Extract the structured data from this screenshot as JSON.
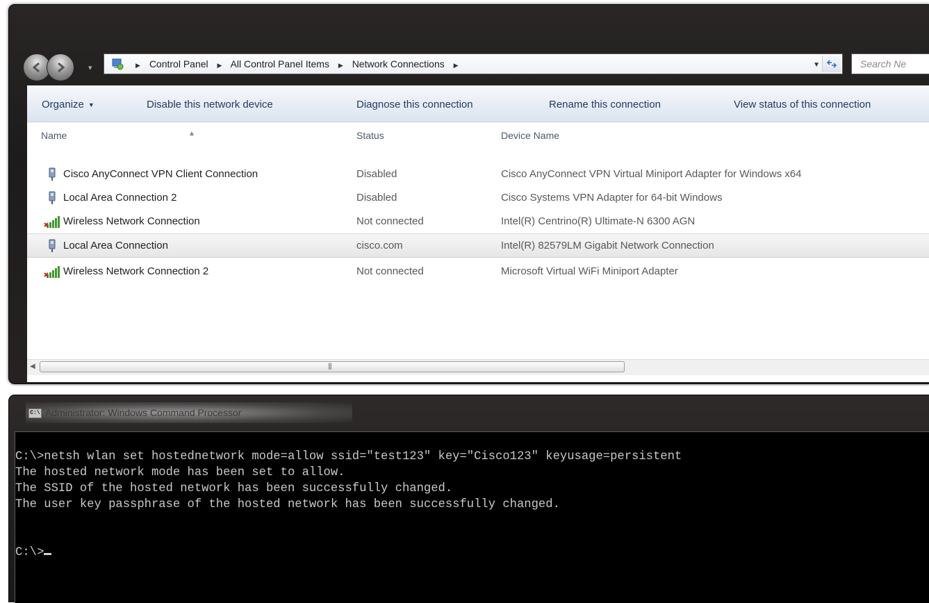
{
  "explorer": {
    "breadcrumb": [
      "Control Panel",
      "All Control Panel Items",
      "Network Connections"
    ],
    "search_placeholder": "Search Ne",
    "toolbar": {
      "organize": "Organize",
      "disable": "Disable this network device",
      "diagnose": "Diagnose this connection",
      "rename": "Rename this connection",
      "view_status": "View status of this connection"
    },
    "columns": {
      "name": "Name",
      "status": "Status",
      "device": "Device Name"
    },
    "connections": [
      {
        "name": "Cisco AnyConnect VPN Client Connection",
        "status": "Disabled",
        "device": "Cisco AnyConnect VPN Virtual Miniport Adapter for Windows x64",
        "icon": "wired-network-icon"
      },
      {
        "name": "Local Area Connection 2",
        "status": "Disabled",
        "device": "Cisco Systems VPN Adapter for 64-bit Windows",
        "icon": "wired-network-icon"
      },
      {
        "name": "Wireless Network Connection",
        "status": "Not connected",
        "device": "Intel(R) Centrino(R) Ultimate-N 6300 AGN",
        "icon": "wireless-signal-icon"
      },
      {
        "name": "Local Area Connection",
        "status": "cisco.com",
        "device": "Intel(R) 82579LM Gigabit Network Connection",
        "icon": "wired-network-icon"
      },
      {
        "name": "Wireless Network Connection 2",
        "status": "Not connected",
        "device": "Microsoft Virtual WiFi Miniport Adapter",
        "icon": "wireless-signal-icon"
      }
    ]
  },
  "cmd": {
    "title": "Administrator: Windows Command Processor",
    "lines": [
      "C:\\>netsh wlan set hostednetwork mode=allow ssid=\"test123\" key=\"Cisco123\" keyusage=persistent",
      "The hosted network mode has been set to allow.",
      "The SSID of the hosted network has been successfully changed.",
      "The user key passphrase of the hosted network has been successfully changed.",
      "",
      "",
      "C:\\>"
    ]
  }
}
